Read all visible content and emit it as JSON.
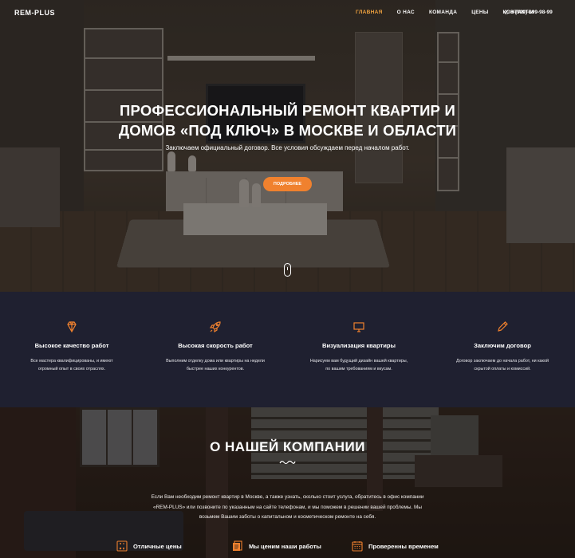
{
  "brand": {
    "logo": "REM-PLUS",
    "accent": "#f0812e"
  },
  "nav": {
    "items": [
      "ГЛАВНАЯ",
      "О НАС",
      "КОМАНДА",
      "ЦЕНЫ",
      "КОНТАКТЫ"
    ],
    "active_index": 0,
    "phone": "8-(999)-999-98-99"
  },
  "hero": {
    "title_line1": "ПРОФЕССИОНАЛЬНЫЙ РЕМОНТ КВАРТИР И",
    "title_line2": "ДОМОВ «ПОД КЛЮЧ» В МОСКВЕ И ОБЛАСТИ",
    "subtitle": "Заключаем официальный договор. Все условия обсуждаем перед началом работ.",
    "button": "ПОДРОБНЕЕ"
  },
  "features": [
    {
      "icon": "diamond-icon",
      "title": "Высокое качество работ",
      "line1": "Все мастера квалифицированы, и имеют",
      "line2": "огромный опыт в своих отраслях."
    },
    {
      "icon": "rocket-icon",
      "title": "Высокая скорость работ",
      "line1": "Выполним отделку дома или квартиры на недели",
      "line2": "быстрее наших конкурентов."
    },
    {
      "icon": "monitor-icon",
      "title": "Визуализация квартиры",
      "line1": "Нарисуем вам будущий дизайн вашей квартиры,",
      "line2": "по вашим требованиям и вкусам."
    },
    {
      "icon": "pencil-icon",
      "title": "Заключим договор",
      "line1": "Договор заключаем до начала работ, ни какой",
      "line2": "скрытой оплаты и комиссий."
    }
  ],
  "about": {
    "title": "О НАШЕЙ КОМПАНИИ",
    "line1": "Если Вам необходим ремонт квартир в Москве, а также узнать, сколько стоит услуга, обратитесь в офис компании",
    "line2": "«REM-PLUS» или позвоните по указанным на сайте телефонам, и мы поможем в решении вашей проблемы. Мы",
    "line3": "возьмем Вашим заботы о капитальном и косметическом ремонте на себя."
  },
  "benefits": [
    {
      "icon": "calculator-icon",
      "label": "Отличные цены"
    },
    {
      "icon": "documents-icon",
      "label": "Мы ценим наши работы"
    },
    {
      "icon": "calendar-icon",
      "label": "Проверенны временем"
    }
  ]
}
